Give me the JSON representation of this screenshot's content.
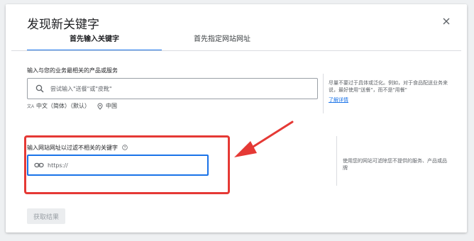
{
  "dialog": {
    "title": "发现新关键字",
    "close_icon": "close-icon"
  },
  "tabs": [
    {
      "label": "首先输入关键字",
      "active": true
    },
    {
      "label": "首先指定网站网址",
      "active": false
    }
  ],
  "keywords_section": {
    "label": "输入与您的业务最相关的产品或服务",
    "input_placeholder": "尝试输入\"送餐\"或\"皮靴\"",
    "language": "中文（简体）（默认）",
    "location": "中国",
    "tip_text": "尽量不要过于具体或泛化。例如，对于食品配送业务来说，最好使用\"送餐\"，而不是\"用餐\"",
    "learn_more": "了解详情"
  },
  "website_section": {
    "label": "输入网站网址以过滤不相关的关键字",
    "input_placeholder": "https://",
    "tip_text": "使用您的网站可滤除您不提供的服务、产品或品牌"
  },
  "actions": {
    "get_results": "获取结果"
  },
  "colors": {
    "accent": "#1a73e8",
    "highlight": "#e53935",
    "disabled_bg": "#ebedef"
  }
}
